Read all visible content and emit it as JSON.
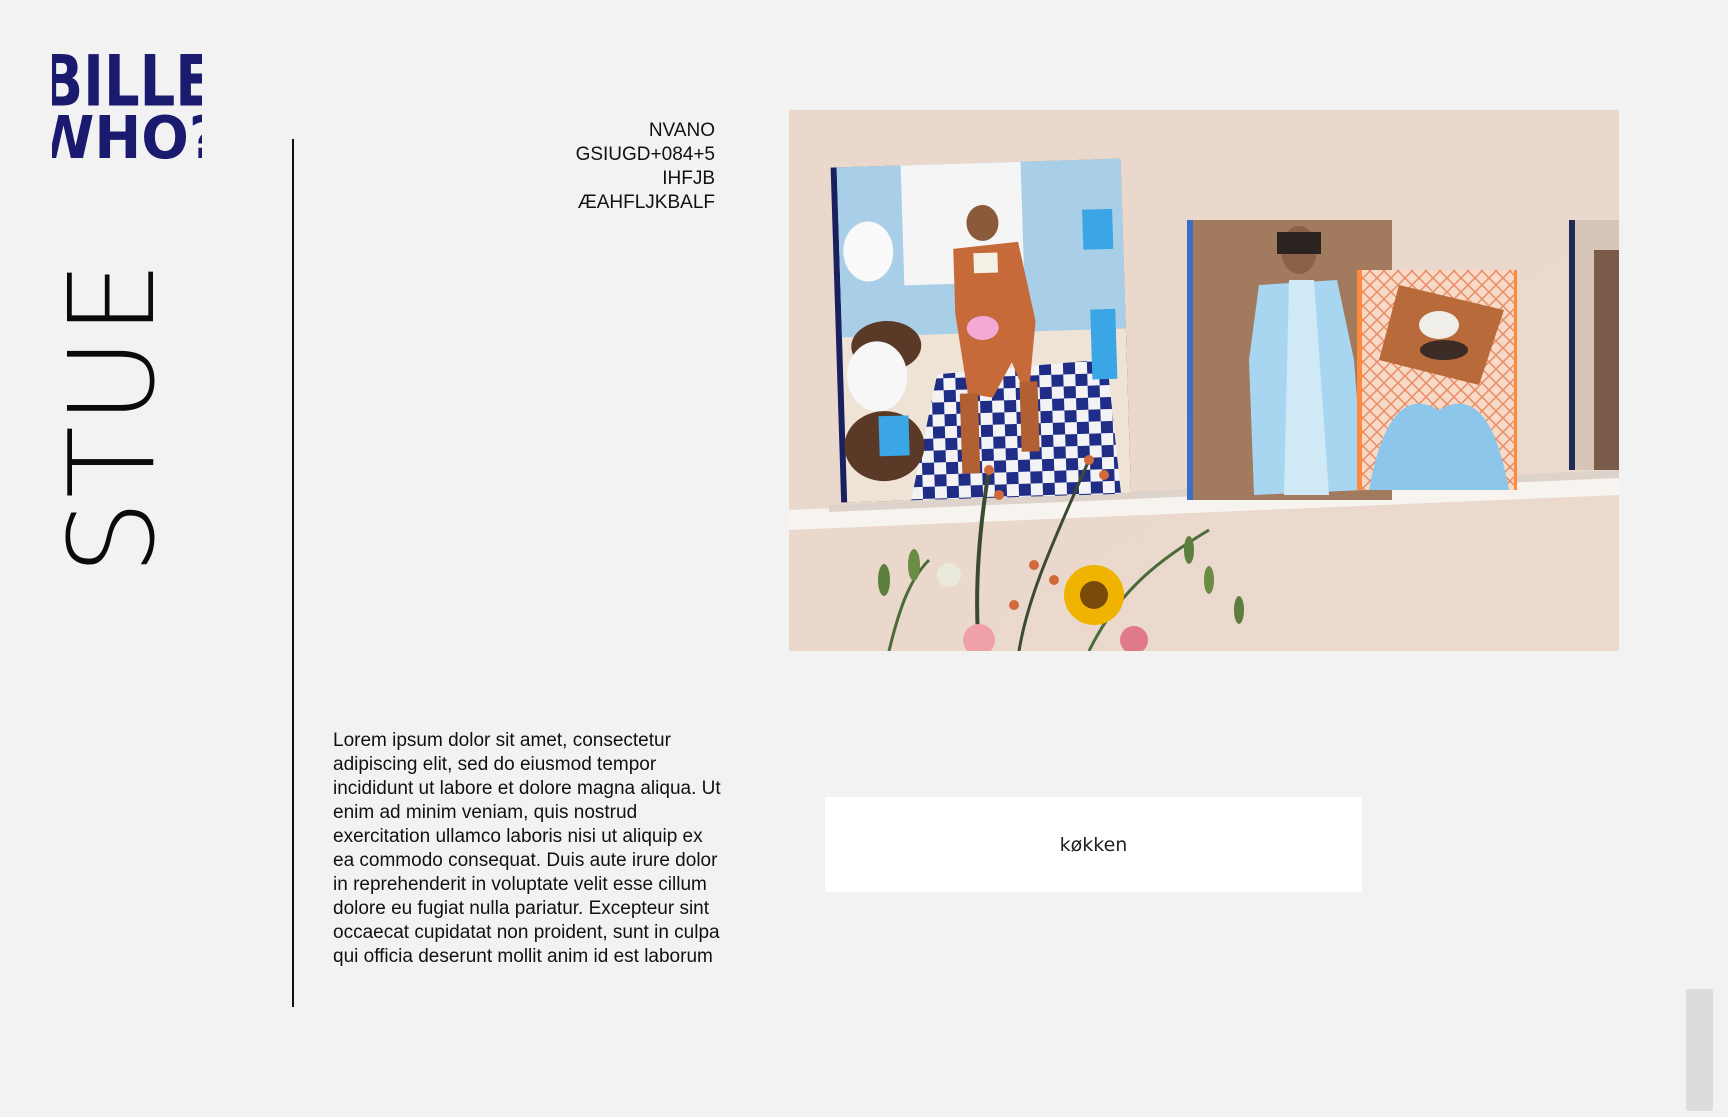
{
  "brand": {
    "logo_text": "BILLE WHO?",
    "logo_line1": "BILLE",
    "logo_line2": "WHO?",
    "logo_color": "#1a1a6e",
    "icon": "logo-badge"
  },
  "page": {
    "room_title": "STUE",
    "meta_lines": [
      "NVANO",
      "GSIUGD+084+5",
      "IHFJB",
      "ÆAHFLJKBALF"
    ]
  },
  "content": {
    "description": "Lorem ipsum dolor sit amet, consectetur adipiscing elit, sed do eiusmod tempor incididunt ut labore et dolore magna aliqua. Ut enim ad minim veniam, quis nostrud exercitation ullamco laboris nisi ut aliquip ex ea commodo consequat. Duis aute irure dolor in reprehenderit in voluptate velit esse cillum dolore eu fugiat nulla pariatur. Excepteur sint occaecat cupidatat non proident, sunt in culpa qui officia deserunt mollit anim id est laborum"
  },
  "navigation": {
    "next_room_label": "køkken"
  },
  "colors": {
    "background": "#f2f2f2",
    "text": "#111111",
    "button_bg": "#ffffff",
    "scrollbar": "#dcdcdc"
  }
}
